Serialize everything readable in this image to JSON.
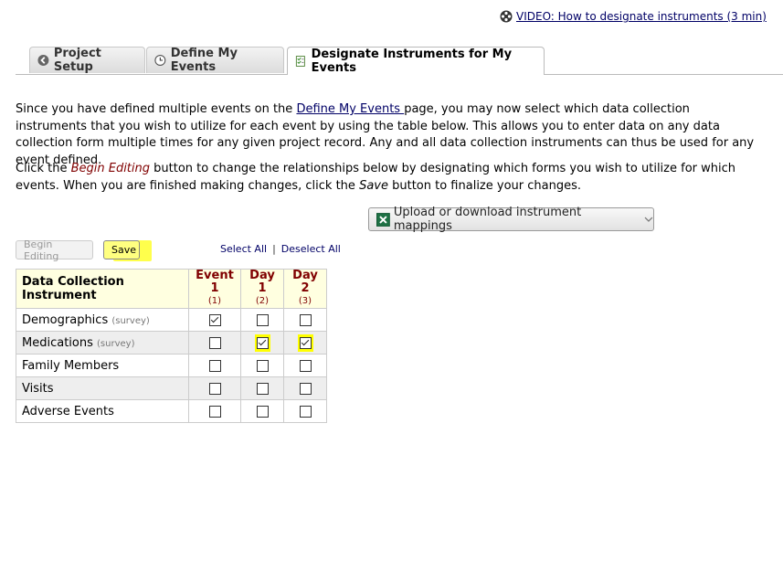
{
  "video_link": {
    "text": "VIDEO: How to designate instruments (3 min)",
    "icon": "film-reel-icon"
  },
  "tabs": [
    {
      "label": "Project Setup",
      "icon": "back-arrow-icon",
      "active": false
    },
    {
      "label": "Define My Events",
      "icon": "clock-icon",
      "active": false
    },
    {
      "label": "Designate Instruments for My Events",
      "icon": "checklist-icon",
      "active": true
    }
  ],
  "intro": {
    "part1": "Since you have defined multiple events on the ",
    "link": "Define My Events ",
    "part2": "page, you may now select which data collection instruments that you wish to utilize for each event by using the table below. This allows you to enter data on any data collection form multiple times for any given project record. Any and all data collection instruments can thus be used for any event defined."
  },
  "instructions": {
    "part1": "Click the ",
    "begin_editing": "Begin Editing",
    "part2": " button to change the relationships below by designating which forms you wish to utilize for which events. When you are finished making changes, click the ",
    "save": "Save",
    "part3": " button to finalize your changes."
  },
  "upload_button": {
    "label": "Upload or download instrument mappings",
    "icon": "excel-icon"
  },
  "buttons": {
    "begin_editing": "Begin Editing",
    "save": "Save"
  },
  "select_links": {
    "select_all": "Select All",
    "deselect_all": "Deselect All"
  },
  "table": {
    "instrument_header": "Data Collection Instrument",
    "events": [
      {
        "name": "Event 1",
        "num": "(1)"
      },
      {
        "name": "Day 1",
        "num": "(2)"
      },
      {
        "name": "Day 2",
        "num": "(3)"
      }
    ],
    "rows": [
      {
        "name": "Demographics",
        "tag": "(survey)",
        "checks": [
          true,
          false,
          false
        ],
        "highlight": [
          false,
          false,
          false
        ]
      },
      {
        "name": "Medications",
        "tag": "(survey)",
        "checks": [
          false,
          true,
          true
        ],
        "highlight": [
          false,
          true,
          true
        ]
      },
      {
        "name": "Family Members",
        "tag": "",
        "checks": [
          false,
          false,
          false
        ],
        "highlight": [
          false,
          false,
          false
        ]
      },
      {
        "name": "Visits",
        "tag": "",
        "checks": [
          false,
          false,
          false
        ],
        "highlight": [
          false,
          false,
          false
        ]
      },
      {
        "name": "Adverse Events",
        "tag": "",
        "checks": [
          false,
          false,
          false
        ],
        "highlight": [
          false,
          false,
          false
        ]
      }
    ]
  },
  "colors": {
    "highlight": "#ffff00",
    "event_header": "#800000",
    "header_bg": "#ffffe0"
  }
}
